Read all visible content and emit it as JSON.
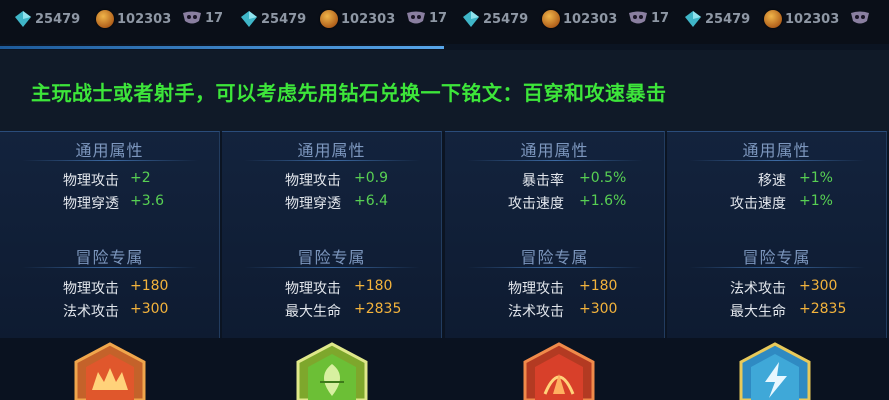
{
  "resource_bar": [
    {
      "gem": "25479",
      "coin": "102303",
      "mask": "17"
    },
    {
      "gem": "25479",
      "coin": "102303",
      "mask": "17"
    },
    {
      "gem": "25479",
      "coin": "102303",
      "mask": "17"
    },
    {
      "gem": "25479",
      "coin": "102303",
      "mask": "17"
    }
  ],
  "headline": "主玩战士或者射手，可以考虑先用钻石兑换一下铭文：百穿和攻速暴击",
  "panels": [
    {
      "general_title": "通用属性",
      "general": [
        {
          "label": "物理攻击",
          "value": "+2"
        },
        {
          "label": "物理穿透",
          "value": "+3.6"
        }
      ],
      "adventure_title": "冒险专属",
      "adventure": [
        {
          "label": "物理攻击",
          "value": "+180"
        },
        {
          "label": "法术攻击",
          "value": "+300"
        }
      ]
    },
    {
      "general_title": "通用属性",
      "general": [
        {
          "label": "物理攻击",
          "value": "+0.9"
        },
        {
          "label": "物理穿透",
          "value": "+6.4"
        }
      ],
      "adventure_title": "冒险专属",
      "adventure": [
        {
          "label": "物理攻击",
          "value": "+180"
        },
        {
          "label": "最大生命",
          "value": "+2835"
        }
      ]
    },
    {
      "general_title": "通用属性",
      "general": [
        {
          "label": "暴击率",
          "value": "+0.5%"
        },
        {
          "label": "攻击速度",
          "value": "+1.6%"
        }
      ],
      "adventure_title": "冒险专属",
      "adventure": [
        {
          "label": "物理攻击",
          "value": "+180"
        },
        {
          "label": "法术攻击",
          "value": "+300"
        }
      ]
    },
    {
      "general_title": "通用属性",
      "general": [
        {
          "label": "移速",
          "value": "+1%"
        },
        {
          "label": "攻击速度",
          "value": "+1%"
        }
      ],
      "adventure_title": "冒险专属",
      "adventure": [
        {
          "label": "法术攻击",
          "value": "+300"
        },
        {
          "label": "最大生命",
          "value": "+2835"
        }
      ]
    }
  ],
  "emblems": [
    {
      "icon": "red-crown-inscription-icon",
      "color": "#e0572c"
    },
    {
      "icon": "green-leaf-inscription-icon",
      "color": "#6cbf36"
    },
    {
      "icon": "red-flame-inscription-icon",
      "color": "#d8402a"
    },
    {
      "icon": "blue-lightning-inscription-icon",
      "color": "#3fa8d8"
    }
  ],
  "colors": {
    "headline": "#3de63a",
    "bonus_green": "#58d053",
    "bonus_orange": "#f3b33c",
    "section_title": "#7d97be"
  }
}
